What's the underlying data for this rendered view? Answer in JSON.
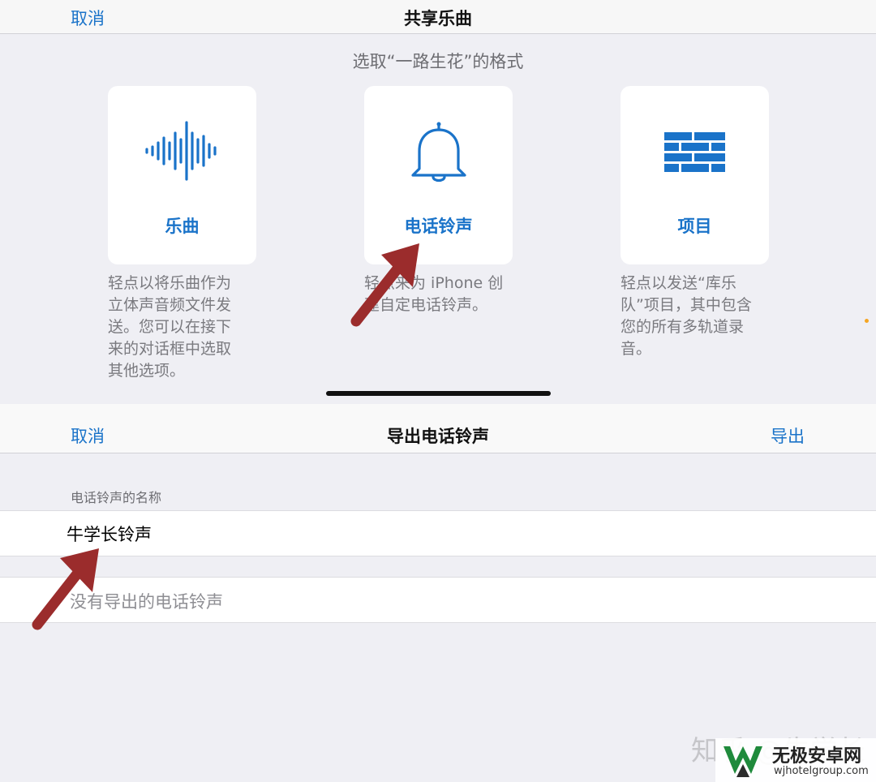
{
  "share_sheet": {
    "cancel_label": "取消",
    "title": "共享乐曲",
    "prompt": "选取“一路生花”的格式",
    "options": [
      {
        "label": "乐曲",
        "icon": "waveform-icon",
        "desc_lines": [
          "轻点以将乐曲作为",
          "立体声音频文件发",
          "送。您可以在接下",
          "来的对话框中选取",
          "其他选项。"
        ]
      },
      {
        "label": "电话铃声",
        "icon": "bell-icon",
        "desc_lines": [
          "轻点来为 iPhone 创",
          "建自定电话铃声。"
        ]
      },
      {
        "label": "项目",
        "icon": "bricks-icon",
        "desc_lines": [
          "轻点以发送“库乐",
          "队”项目，其中包含",
          "您的所有多轨道录",
          "音。"
        ]
      }
    ]
  },
  "export_sheet": {
    "cancel_label": "取消",
    "title": "导出电话铃声",
    "export_label": "导出",
    "name_section_label": "电话铃声的名称",
    "ringtone_name_value": "牛学长铃声",
    "empty_list_text": "没有导出的电话铃声"
  },
  "watermark": {
    "text": "知乎 @牛学长",
    "site_name": "无极安卓网",
    "site_url": "wjhotelgroup.com"
  },
  "colors": {
    "accent": "#1a73c9",
    "annotation_arrow": "#9b2c2c"
  }
}
